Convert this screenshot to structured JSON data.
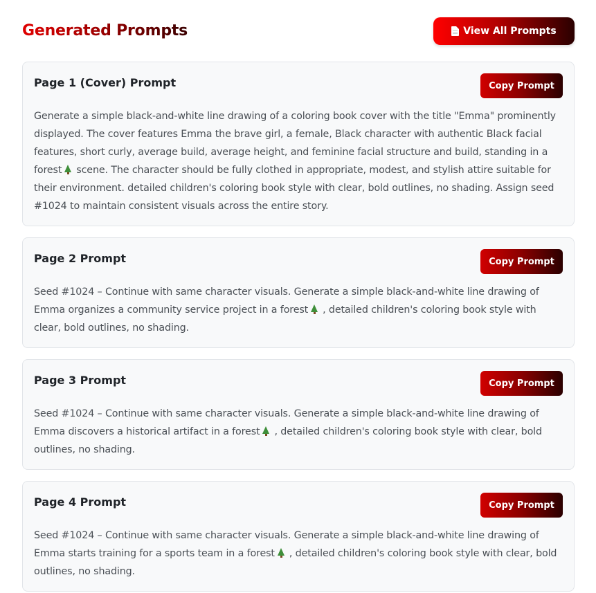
{
  "header": {
    "title": "Generated Prompts",
    "view_all_label": "View All Prompts",
    "view_all_icon": "document-icon"
  },
  "colors": {
    "accent_red": "#e00000",
    "accent_dark": "#2a0000",
    "card_bg": "#f8f9fa",
    "tree_green": "#3f8f3a"
  },
  "prompts": [
    {
      "title": "Page 1 (Cover) Prompt",
      "copy_label": "Copy Prompt",
      "text_before": "Generate a simple black-and-white line drawing of a coloring book cover with the title \"Emma\" prominently displayed. The cover features Emma the brave girl, a female, Black character with authentic Black facial features, short curly, average build, average height, and feminine facial structure and build, standing in a forest",
      "icon": "tree-icon",
      "text_after": "scene. The character should be fully clothed in appropriate, modest, and stylish attire suitable for their environment. detailed children's coloring book style with clear, bold outlines, no shading. Assign seed #1024 to maintain consistent visuals across the entire story."
    },
    {
      "title": "Page 2 Prompt",
      "copy_label": "Copy Prompt",
      "text_before": "Seed #1024 – Continue with same character visuals. Generate a simple black-and-white line drawing of Emma organizes a community service project in a forest",
      "icon": "tree-icon",
      "text_after": ", detailed children's coloring book style with clear, bold outlines, no shading."
    },
    {
      "title": "Page 3 Prompt",
      "copy_label": "Copy Prompt",
      "text_before": "Seed #1024 – Continue with same character visuals. Generate a simple black-and-white line drawing of Emma discovers a historical artifact in a forest",
      "icon": "tree-icon",
      "text_after": ", detailed children's coloring book style with clear, bold outlines, no shading."
    },
    {
      "title": "Page 4 Prompt",
      "copy_label": "Copy Prompt",
      "text_before": "Seed #1024 – Continue with same character visuals. Generate a simple black-and-white line drawing of Emma starts training for a sports team in a forest",
      "icon": "tree-icon",
      "text_after": ", detailed children's coloring book style with clear, bold outlines, no shading."
    }
  ]
}
